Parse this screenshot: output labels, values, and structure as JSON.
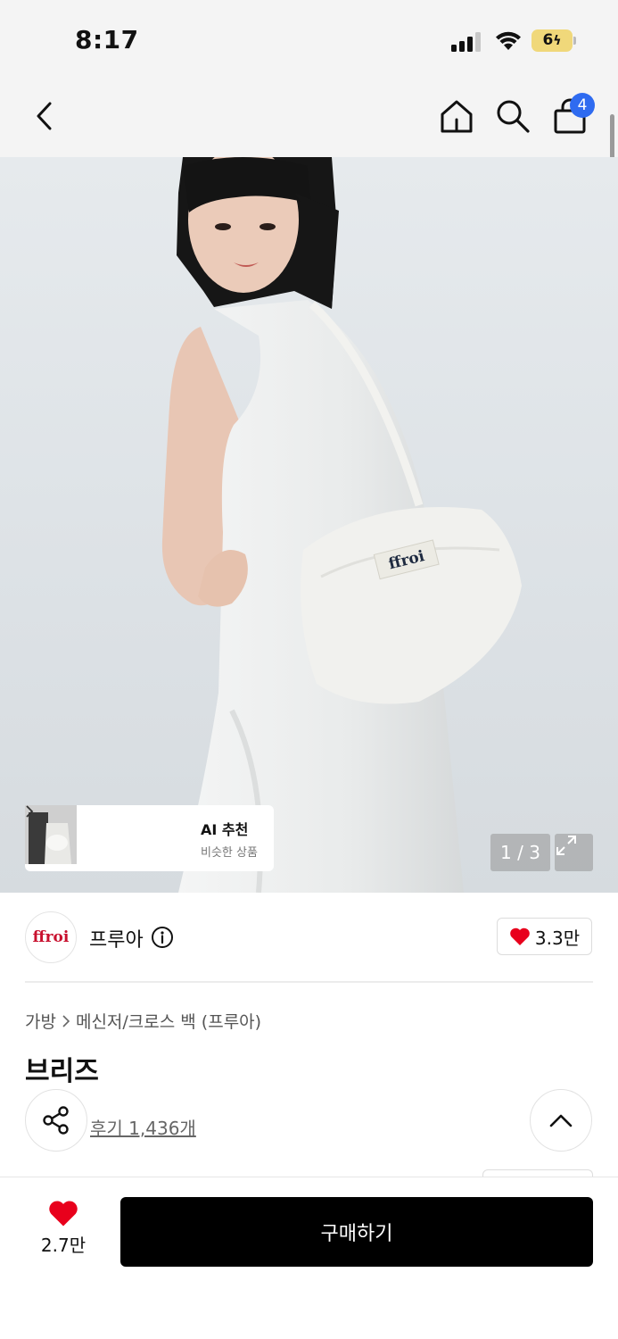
{
  "status_bar": {
    "time": "8:17",
    "battery": "6"
  },
  "nav": {
    "cart_count": "4",
    "icons": [
      "chevron-left-icon",
      "home-icon",
      "search-icon",
      "shopping-bag-icon"
    ]
  },
  "hero": {
    "ai_recommend": {
      "title": "AI 추천",
      "subtitle": "비슷한 상품"
    },
    "page_indicator": "1 / 3",
    "brand_tag": "ffroi"
  },
  "brand": {
    "logo_text": "ffroi",
    "name": "프루아",
    "likes": "3.3만",
    "logo_color": "#c8102e"
  },
  "product": {
    "breadcrumb": [
      "가방",
      "메신저/크로스 백 (프루아)"
    ],
    "title": "브리즈",
    "reviews": "후기 1,436개"
  },
  "bottom_bar": {
    "wish_count": "2.7만",
    "buy_label": "구매하기",
    "heart_color": "#e8001c"
  }
}
